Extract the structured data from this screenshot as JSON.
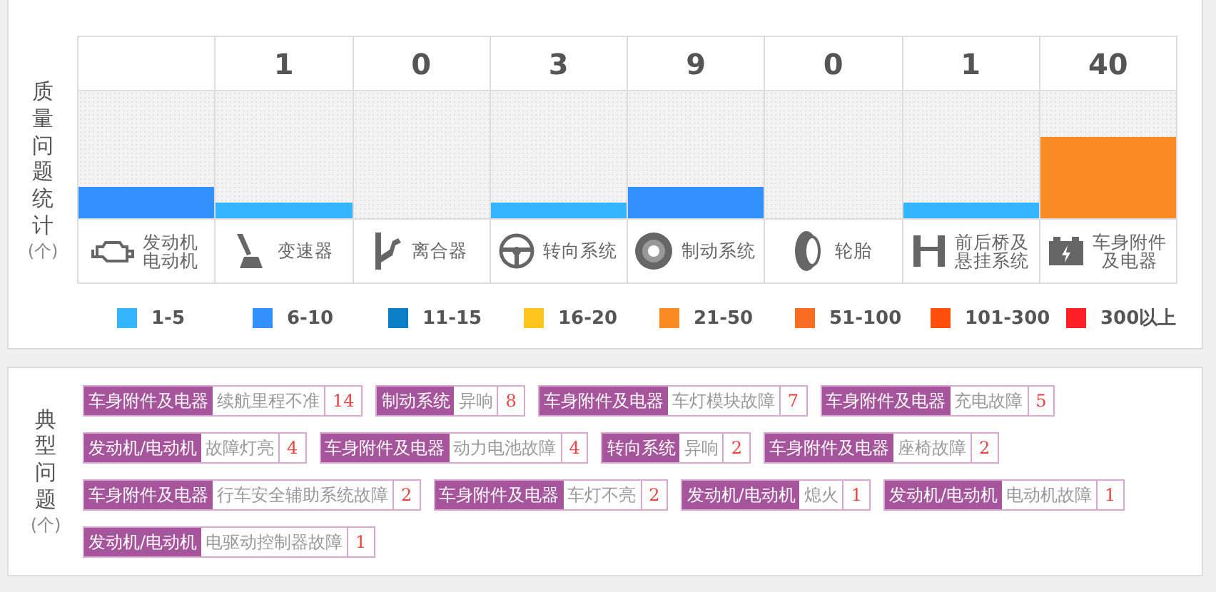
{
  "stats": {
    "label": "质量问题统计",
    "unit": "(个)",
    "columns": [
      {
        "color": "#3390ff",
        "name": "发动机电动机"
      },
      {
        "count": "1",
        "color": "#33b5ff",
        "name": "变速器"
      },
      {
        "count": "0",
        "name": "离合器"
      },
      {
        "count": "3",
        "color": "#33b5ff",
        "name": "转向系统"
      },
      {
        "count": "9",
        "color": "#3390ff",
        "name": "制动系统"
      },
      {
        "count": "0",
        "name": "轮胎"
      },
      {
        "count": "1",
        "color": "#33b5ff",
        "name": "前后桥及悬挂系统"
      },
      {
        "count": "40",
        "color": "#fa8a22",
        "name": "车身附件及电器"
      }
    ],
    "legend": [
      {
        "label": "1-5",
        "color": "#33b5ff"
      },
      {
        "label": "6-10",
        "color": "#3390ff"
      },
      {
        "label": "11-15",
        "color": "#0a7fc7"
      },
      {
        "label": "16-20",
        "color": "#ffc61f"
      },
      {
        "label": "21-50",
        "color": "#fa8a22"
      },
      {
        "label": "51-100",
        "color": "#fa6c22"
      },
      {
        "label": "101-300",
        "color": "#ff4f0a"
      },
      {
        "label": "300以上",
        "color": "#ff1f24"
      }
    ]
  },
  "issues": {
    "label": "典型问题",
    "unit": "(个)",
    "items": [
      {
        "category": "车身附件及电器",
        "problem": "续航里程不准",
        "count": "14"
      },
      {
        "category": "制动系统",
        "problem": "异响",
        "count": "8"
      },
      {
        "category": "车身附件及电器",
        "problem": "车灯模块故障",
        "count": "7"
      },
      {
        "category": "车身附件及电器",
        "problem": "充电故障",
        "count": "5"
      },
      {
        "category": "发动机/电动机",
        "problem": "故障灯亮",
        "count": "4"
      },
      {
        "category": "车身附件及电器",
        "problem": "动力电池故障",
        "count": "4"
      },
      {
        "category": "转向系统",
        "problem": "异响",
        "count": "2"
      },
      {
        "category": "车身附件及电器",
        "problem": "座椅故障",
        "count": "2"
      },
      {
        "category": "车身附件及电器",
        "problem": "行车安全辅助系统故障",
        "count": "2"
      },
      {
        "category": "车身附件及电器",
        "problem": "车灯不亮",
        "count": "2"
      },
      {
        "category": "发动机/电动机",
        "problem": "熄火",
        "count": "1"
      },
      {
        "category": "发动机/电动机",
        "problem": "电动机故障",
        "count": "1"
      },
      {
        "category": "发动机/电动机",
        "problem": "电驱动控制器故障",
        "count": "1"
      }
    ]
  }
}
